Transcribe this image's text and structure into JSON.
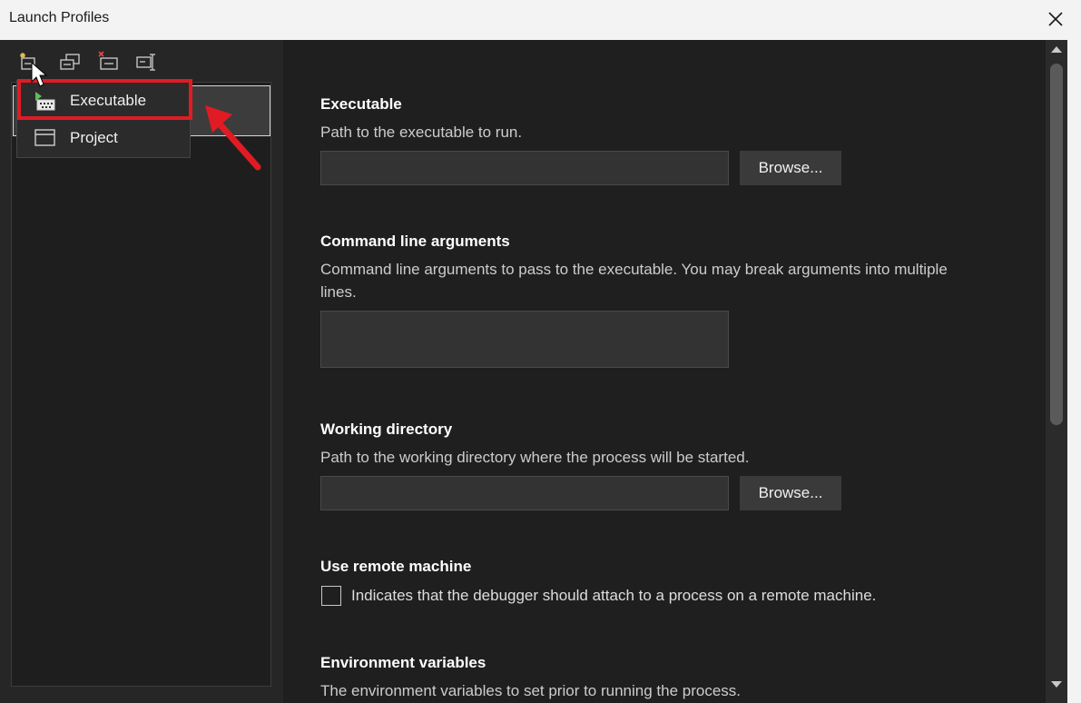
{
  "window": {
    "title": "Launch Profiles"
  },
  "toolbar": {
    "icons": [
      "new-profile-icon",
      "copy-profile-icon",
      "delete-profile-icon",
      "rename-profile-icon"
    ]
  },
  "menu": {
    "items": [
      {
        "label": "Executable",
        "icon": "executable-icon",
        "highlighted": true
      },
      {
        "label": "Project",
        "icon": "project-window-icon",
        "highlighted": false
      }
    ]
  },
  "sections": {
    "executable": {
      "title": "Executable",
      "description": "Path to the executable to run.",
      "value": "",
      "browse_label": "Browse..."
    },
    "args": {
      "title": "Command line arguments",
      "description_line1": "Command line arguments to pass to the executable. You may break arguments into multiple",
      "description_line2": "lines.",
      "value": ""
    },
    "workdir": {
      "title": "Working directory",
      "description": "Path to the working directory where the process will be started.",
      "value": "",
      "browse_label": "Browse..."
    },
    "remote": {
      "title": "Use remote machine",
      "checkbox_label": "Indicates that the debugger should attach to a process on a remote machine.",
      "checked": false
    },
    "env": {
      "title": "Environment variables",
      "description": "The environment variables to set prior to running the process."
    }
  },
  "colors": {
    "accent_highlight": "#e01b24",
    "background": "#1f1f1f",
    "panel": "#262626"
  }
}
